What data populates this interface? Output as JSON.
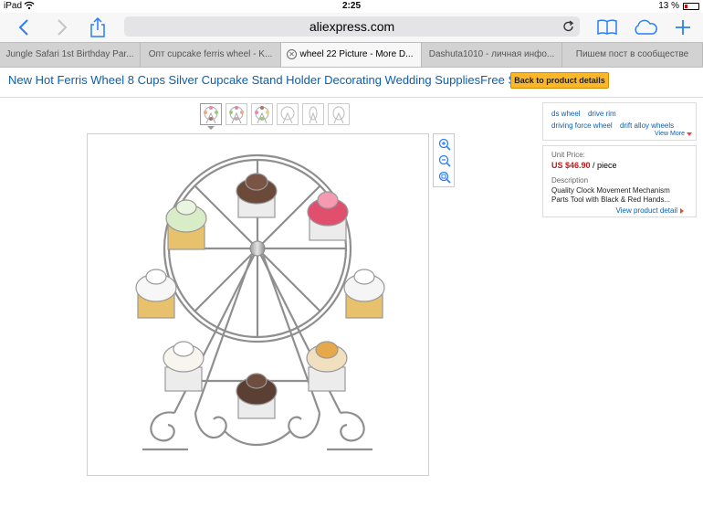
{
  "status_bar": {
    "device": "iPad",
    "time": "2:25",
    "battery": "13 %"
  },
  "browser": {
    "url": "aliexpress.com",
    "icons": [
      "back-icon",
      "forward-icon",
      "share-icon",
      "reload-icon",
      "bookmarks-icon",
      "cloud-tabs-icon",
      "new-tab-icon"
    ]
  },
  "tabs": [
    {
      "label": "Jungle Safari 1st Birthday Par..."
    },
    {
      "label": "Опт cupcake ferris wheel - K..."
    },
    {
      "label": "wheel 22 Picture - More D..."
    },
    {
      "label": "Dashuta1010 - личная инфо..."
    },
    {
      "label": "Пишем пост в сообществе"
    }
  ],
  "page": {
    "title": "New Hot Ferris Wheel 8 Cups Silver Cupcake Stand Holder Decorating Wedding SuppliesFree Shipping",
    "back_button": "Back to product details"
  },
  "tags": {
    "items": [
      "ds wheel",
      "drive rim",
      "driving force wheel",
      "drift alloy wheels"
    ],
    "view_more": "View More"
  },
  "product": {
    "unit_price_label": "Unit Price:",
    "price": "US $46.90",
    "unit": "/ piece",
    "description_label": "Description",
    "description": "Quality Clock Movement Mechanism Parts Tool with Black & Red Hands...",
    "view_detail": "View product detail"
  },
  "colors": {
    "link": "#0b5fb0",
    "button": "#fbb728",
    "price": "#c0191a",
    "accent_caret": "#e5502a",
    "ios_blue": "#2a7ff5"
  }
}
